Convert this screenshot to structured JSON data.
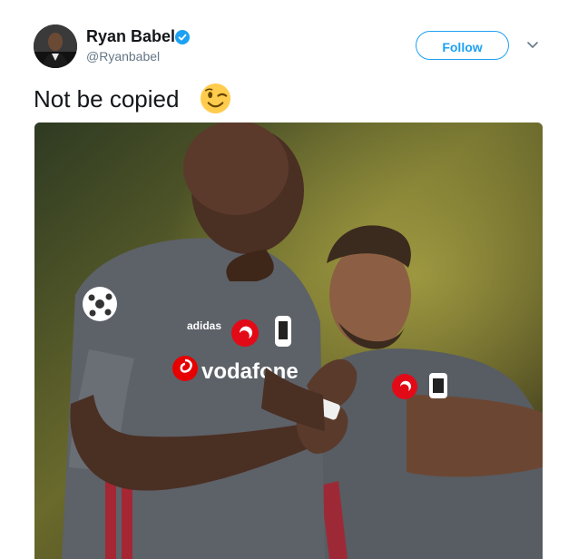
{
  "user": {
    "display_name": "Ryan Babel",
    "handle": "@Ryanbabel",
    "verified": true,
    "avatar_icon": "avatar-photo"
  },
  "actions": {
    "follow_label": "Follow",
    "menu_icon": "chevron-down-icon"
  },
  "tweet": {
    "text": "Not be copied",
    "emoji": "winking-face-emoji"
  },
  "media": {
    "type": "photo",
    "jersey_text": "vodafone",
    "jersey_brand": "adidas"
  },
  "colors": {
    "accent": "#1da1f2",
    "text": "#14171a",
    "secondary_text": "#657786",
    "jersey": "#5d6168"
  }
}
